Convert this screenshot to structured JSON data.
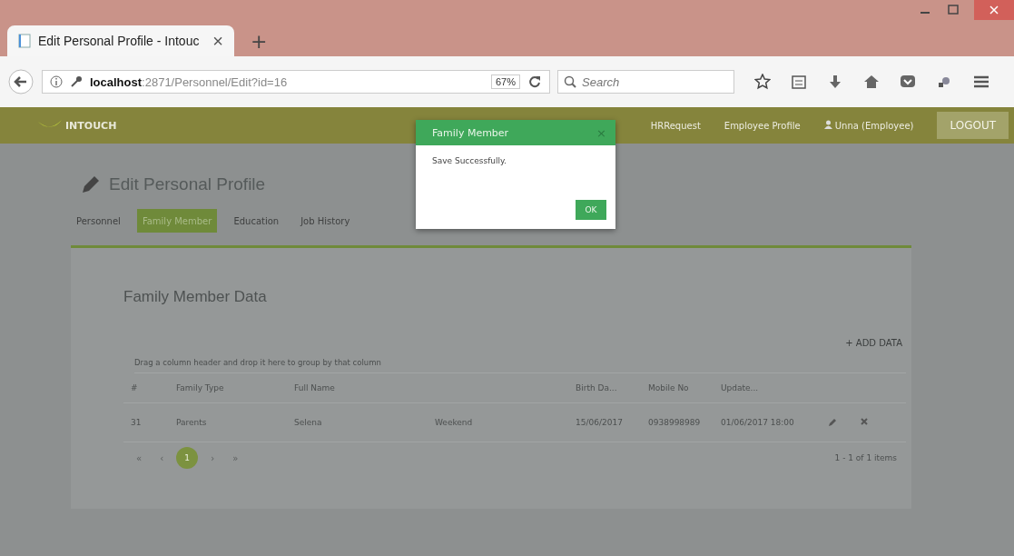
{
  "browser": {
    "tab_title": "Edit Personal Profile - Intouc",
    "tab_close": "×",
    "new_tab": "+",
    "url_host": "localhost",
    "url_path": ":2871/Personnel/Edit?id=16",
    "zoom": "67%",
    "search": {
      "placeholder": "Search"
    }
  },
  "navbar": {
    "logo": "INTOUCH",
    "items": [
      {
        "label": "HRRequest",
        "kind": "link"
      },
      {
        "label": "Employee Profile",
        "kind": "link"
      },
      {
        "label": "Unna (Employee)",
        "kind": "user"
      }
    ],
    "logout": "LOGOUT"
  },
  "page": {
    "title": "Edit Personal Profile",
    "tabs": [
      {
        "label": "Personnel",
        "selected": false
      },
      {
        "label": "Family Member",
        "selected": true
      },
      {
        "label": "Education",
        "selected": false
      },
      {
        "label": "Job History",
        "selected": false
      }
    ],
    "section_title": "Family Member Data",
    "add_button": "+ ADD DATA",
    "group_hint": "Drag a column header and drop it here to group by that column",
    "columns": [
      "#",
      "Family Type",
      "Full Name",
      "",
      "Birth Da...",
      "Mobile No",
      "Update..."
    ],
    "rows": [
      {
        "cells": [
          "31",
          "Parents",
          "Selena",
          "Weekend",
          "15/06/2017",
          "0938998989",
          "01/06/2017 18:00"
        ]
      }
    ],
    "pagination": {
      "first": "«",
      "prev": "‹",
      "pages": [
        {
          "label": "1",
          "selected": true
        }
      ],
      "next": "›",
      "last": "»",
      "summary": "1 - 1 of 1 items"
    }
  },
  "dialog": {
    "title": "Family Member",
    "close": "×",
    "message": "Save Successfully.",
    "ok": "OK"
  }
}
